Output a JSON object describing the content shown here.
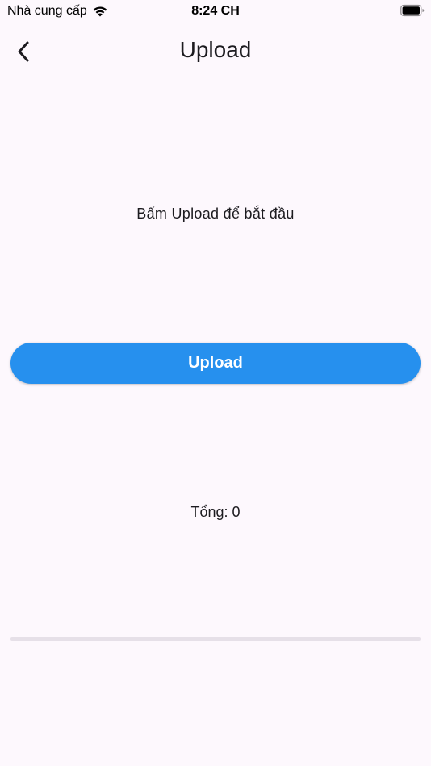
{
  "status_bar": {
    "carrier": "Nhà cung cấp",
    "time": "8:24 CH",
    "wifi_icon": "wifi-icon",
    "battery_icon": "battery-icon"
  },
  "app_bar": {
    "title": "Upload",
    "back_icon": "chevron-left-icon"
  },
  "main": {
    "instruction": "Bấm Upload để bắt đầu",
    "upload_button_label": "Upload",
    "total_label": "Tổng: 0",
    "progress": 0
  },
  "colors": {
    "background": "#fdf8fd",
    "accent": "#2690ee",
    "progress_track": "#e6e0e8",
    "text": "#1c1b1f"
  }
}
